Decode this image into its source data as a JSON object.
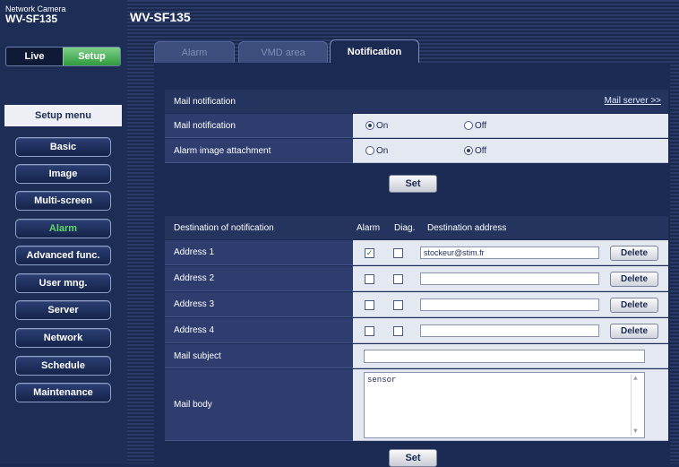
{
  "brand": {
    "line1": "Network Camera",
    "line2": "WV-SF135"
  },
  "mode": {
    "live": "Live",
    "setup": "Setup"
  },
  "sidebar": {
    "title": "Setup menu",
    "items": [
      {
        "label": "Basic"
      },
      {
        "label": "Image"
      },
      {
        "label": "Multi-screen"
      },
      {
        "label": "Alarm"
      },
      {
        "label": "Advanced func."
      },
      {
        "label": "User mng."
      },
      {
        "label": "Server"
      },
      {
        "label": "Network"
      },
      {
        "label": "Schedule"
      },
      {
        "label": "Maintenance"
      }
    ],
    "active": "Alarm"
  },
  "header": {
    "title": "WV-SF135"
  },
  "tabs": [
    {
      "label": "Alarm"
    },
    {
      "label": "VMD area"
    },
    {
      "label": "Notification"
    }
  ],
  "mail": {
    "section_title": "Mail notification",
    "server_link": "Mail server >>",
    "rows": [
      {
        "label": "Mail notification",
        "on": "On",
        "off": "Off",
        "selected": "On"
      },
      {
        "label": "Alarm image attachment",
        "on": "On",
        "off": "Off",
        "selected": "Off"
      }
    ],
    "set_label": "Set"
  },
  "destination": {
    "header_label": "Destination of notification",
    "col_alarm": "Alarm",
    "col_diag": "Diag.",
    "col_address": "Destination address",
    "addresses": [
      {
        "label": "Address 1",
        "alarm": true,
        "diag": false,
        "value": "stockeur@stim.fr"
      },
      {
        "label": "Address 2",
        "alarm": false,
        "diag": false,
        "value": ""
      },
      {
        "label": "Address 3",
        "alarm": false,
        "diag": false,
        "value": ""
      },
      {
        "label": "Address 4",
        "alarm": false,
        "diag": false,
        "value": ""
      }
    ],
    "delete_label": "Delete",
    "subject_label": "Mail subject",
    "subject_value": "",
    "body_label": "Mail body",
    "body_value": "sensor",
    "set_label": "Set"
  }
}
